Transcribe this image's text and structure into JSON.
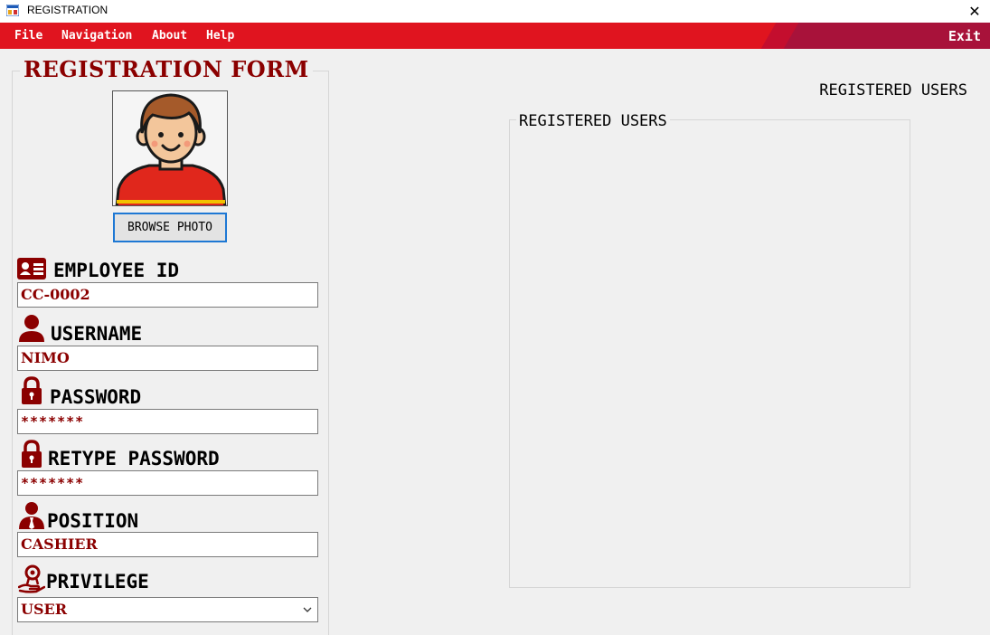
{
  "window": {
    "title": "REGISTRATION",
    "close_glyph": "✕"
  },
  "menu": {
    "items": [
      "File",
      "Navigation",
      "About",
      "Help"
    ],
    "exit": "Exit",
    "color": "#e0141f"
  },
  "form": {
    "title": "REGISTRATION FORM",
    "browse_label": "BROWSE PHOTO",
    "fields": {
      "employee_id": {
        "label": "EMPLOYEE ID",
        "value": "CC-0002",
        "icon": "id-card-icon"
      },
      "username": {
        "label": "USERNAME",
        "value": "NIMO",
        "icon": "user-icon"
      },
      "password": {
        "label": "PASSWORD",
        "value": "*******",
        "icon": "lock-icon"
      },
      "retype_password": {
        "label": "RETYPE PASSWORD",
        "value": "*******",
        "icon": "lock-icon"
      },
      "position": {
        "label": "POSITION",
        "value": "CASHIER",
        "icon": "employee-icon"
      },
      "privilege": {
        "label": "PRIVILEGE",
        "value": "USER",
        "icon": "badge-hand-icon"
      }
    }
  },
  "users": {
    "heading": "REGISTERED USERS",
    "group_label": "REGISTERED USERS"
  },
  "colors": {
    "accent": "#8b0000",
    "menu_dark": "#a8123a"
  }
}
